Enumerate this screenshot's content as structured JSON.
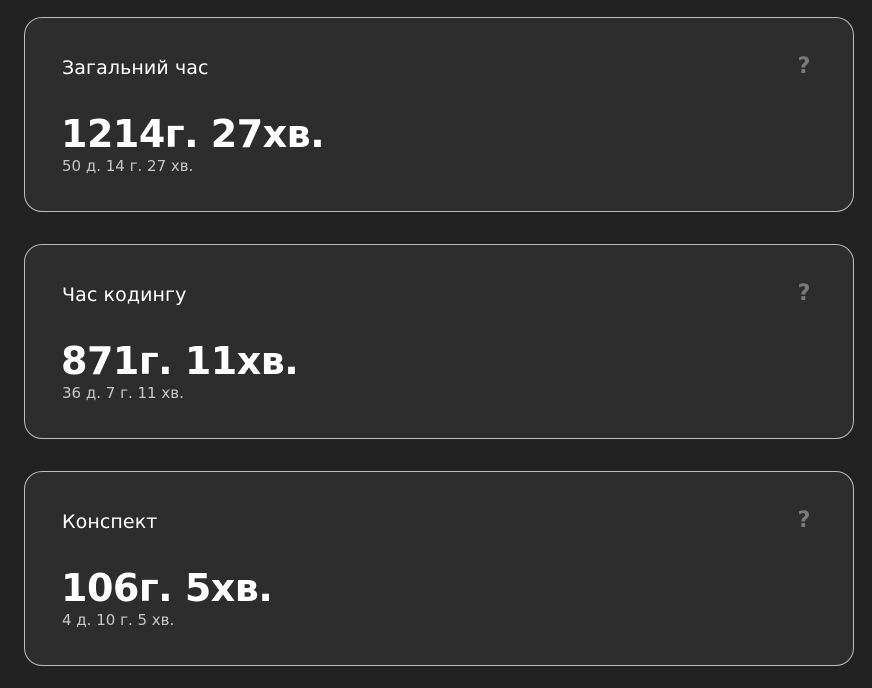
{
  "colors": {
    "page_background": "#222222",
    "card_background": "#2d2d2d",
    "card_border": "#bdbdbd",
    "help_icon": "#7a7a7a"
  },
  "help_icon_name": "question-mark-icon",
  "help_icon_glyph": "?",
  "cards": [
    {
      "title": "Загальний час",
      "value": "1214г. 27хв.",
      "detail": "50 д. 14 г. 27 хв."
    },
    {
      "title": "Час кодингу",
      "value": "871г. 11хв.",
      "detail": "36 д. 7 г. 11 хв."
    },
    {
      "title": "Конспект",
      "value": "106г. 5хв.",
      "detail": "4 д. 10 г. 5 хв."
    }
  ]
}
